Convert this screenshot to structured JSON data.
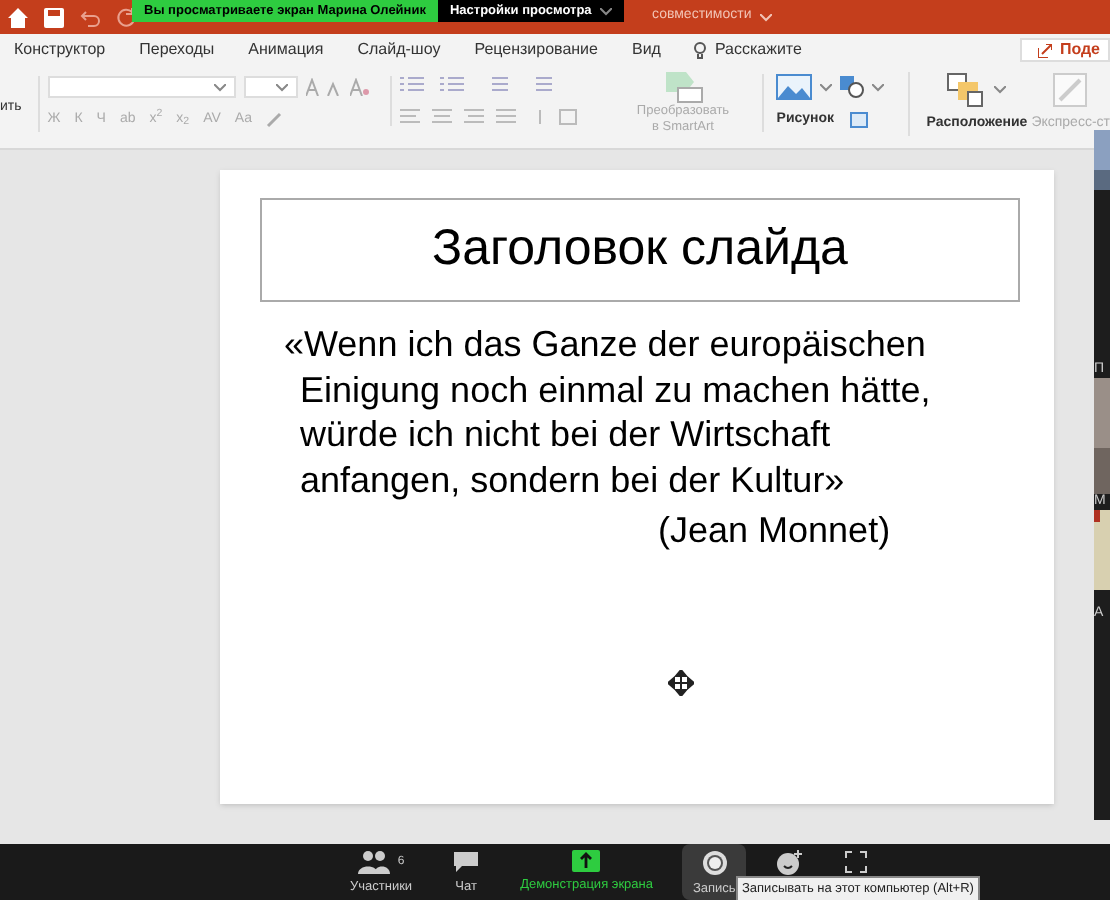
{
  "title_bar": {
    "title_fragment": "совместимости"
  },
  "share_banner": {
    "text": "Вы просматриваете экран Марина Олейник",
    "view_options": "Настройки просмотра"
  },
  "ribbon_tabs": [
    {
      "label": "Конструктор"
    },
    {
      "label": "Переходы"
    },
    {
      "label": "Анимация"
    },
    {
      "label": "Слайд-шоу"
    },
    {
      "label": "Рецензирование"
    },
    {
      "label": "Вид"
    }
  ],
  "tell_me": "Расскажите",
  "share_button": "Поде",
  "ribbon": {
    "paste_label": "ить",
    "format_buttons": [
      "Ж",
      "К",
      "Ч",
      "ab",
      "x$^{2}$",
      "x$_{2}$",
      "AV",
      "Aa"
    ],
    "smartart": [
      "Преобразовать",
      "в SmartArt"
    ],
    "picture": "Рисунок",
    "arrange": "Расположение",
    "quick_styles": "Экспресс-ст"
  },
  "slide": {
    "title": "Заголовок слайда",
    "quote_lines": [
      "«Wenn ich das Ganze der europäischen",
      "Einigung noch einmal zu machen hätte,",
      "würde ich nicht bei der Wirtschaft",
      "anfangen, sondern bei der Kultur»"
    ],
    "author": "(Jean Monnet)"
  },
  "gallery_labels": [
    "П",
    "М",
    "А"
  ],
  "meeting_bar": [
    {
      "kind": "participants",
      "label": "Участники",
      "count": "6",
      "selected": false
    },
    {
      "kind": "chat",
      "label": "Чат",
      "selected": false
    },
    {
      "kind": "share",
      "label": "Демонстрация экрана",
      "selected": false
    },
    {
      "kind": "record",
      "label": "Запись",
      "selected": true
    },
    {
      "kind": "reactions",
      "selected": false
    },
    {
      "kind": "more",
      "selected": false
    }
  ],
  "tooltip": "Записывать на этот компьютер (Alt+R)"
}
